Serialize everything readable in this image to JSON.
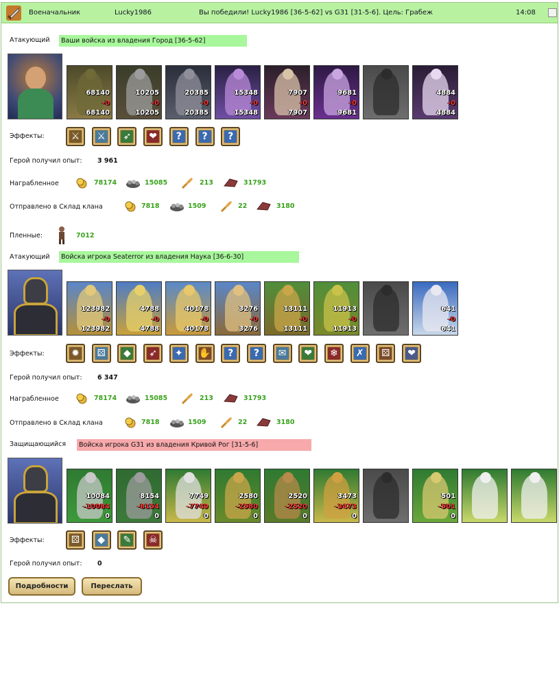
{
  "header": {
    "role": "Военачальник",
    "player": "Lucky1986",
    "message": "Вы победили! Lucky1986 [36-5-62] vs G31 [31-5-6]. Цель: Грабеж",
    "time": "14:08"
  },
  "labels": {
    "effects": "Эффекты:",
    "exp": "Герой получил опыт:",
    "loot": "Награбленное",
    "clan": "Отправлено в Склад клана",
    "prisoners": "Пленные:"
  },
  "armies": [
    {
      "role": "Атакующий",
      "bar": "Ваши войска из владения Город [36-5-62]",
      "exp": "3 961",
      "units": [
        {
          "a": "68140",
          "b": "-0",
          "c": "68140"
        },
        {
          "a": "10205",
          "b": "-0",
          "c": "10205"
        },
        {
          "a": "20385",
          "b": "-0",
          "c": "20385"
        },
        {
          "a": "15348",
          "b": "-0",
          "c": "15348"
        },
        {
          "a": "7907",
          "b": "-0",
          "c": "7907"
        },
        {
          "a": "9681",
          "b": "-0",
          "c": "9681"
        },
        {
          "a": "",
          "b": "",
          "c": ""
        },
        {
          "a": "4884",
          "b": "-0",
          "c": "4884"
        }
      ],
      "loot": [
        "78174",
        "15085",
        "213",
        "31793"
      ],
      "clan": [
        "7818",
        "1509",
        "22",
        "3180"
      ],
      "prisoners": "7012"
    },
    {
      "role": "Атакующий",
      "bar": "Войска игрока Seaterror из владения Наука [36-6-30]",
      "exp": "6 347",
      "units": [
        {
          "a": "123982",
          "b": "-0",
          "c": "123982"
        },
        {
          "a": "4788",
          "b": "-0",
          "c": "4788"
        },
        {
          "a": "40178",
          "b": "-0",
          "c": "40178"
        },
        {
          "a": "3276",
          "b": "-0",
          "c": "3276"
        },
        {
          "a": "13111",
          "b": "-0",
          "c": "13111"
        },
        {
          "a": "11913",
          "b": "-0",
          "c": "11913"
        },
        {
          "a": "",
          "b": "",
          "c": ""
        },
        {
          "a": "641",
          "b": "-0",
          "c": "641"
        }
      ],
      "loot": [
        "78174",
        "15085",
        "213",
        "31793"
      ],
      "clan": [
        "7818",
        "1509",
        "22",
        "3180"
      ]
    },
    {
      "role": "Защищающийся",
      "bar": "Войска игрока G31 из владения Кривой Рог [31-5-6]",
      "exp": "0",
      "units": [
        {
          "a": "10084",
          "b": "-10084",
          "c": "0"
        },
        {
          "a": "8154",
          "b": "-8154",
          "c": "0"
        },
        {
          "a": "7749",
          "b": "-7749",
          "c": "0"
        },
        {
          "a": "2580",
          "b": "-2580",
          "c": "0"
        },
        {
          "a": "2520",
          "b": "-2520",
          "c": "0"
        },
        {
          "a": "3473",
          "b": "-3473",
          "c": "0"
        },
        {
          "a": "",
          "b": "",
          "c": ""
        },
        {
          "a": "501",
          "b": "-501",
          "c": "0"
        },
        {
          "a": "",
          "b": "",
          "c": ""
        },
        {
          "a": "",
          "b": "",
          "c": ""
        }
      ]
    }
  ],
  "effects_glyphs": {
    "a1": [
      "⚔",
      "⚔",
      "➶",
      "❤",
      "?",
      "?",
      "?"
    ],
    "a2": [
      "✹",
      "⚄",
      "◆",
      "➶",
      "✦",
      "✋",
      "?",
      "?",
      "✉",
      "❤",
      "❄",
      "✗",
      "⚄",
      "❤"
    ],
    "d": [
      "⚄",
      "◆",
      "✎",
      "☠"
    ]
  },
  "buttons": {
    "details": "Подробности",
    "forward": "Переслать"
  },
  "colors": {
    "header_bg": "#b8f2a0",
    "bar_green": "#a8f79c",
    "bar_red": "#f7a9ab",
    "resource_text": "#39a21c",
    "loss_text": "#ff3b3b"
  }
}
